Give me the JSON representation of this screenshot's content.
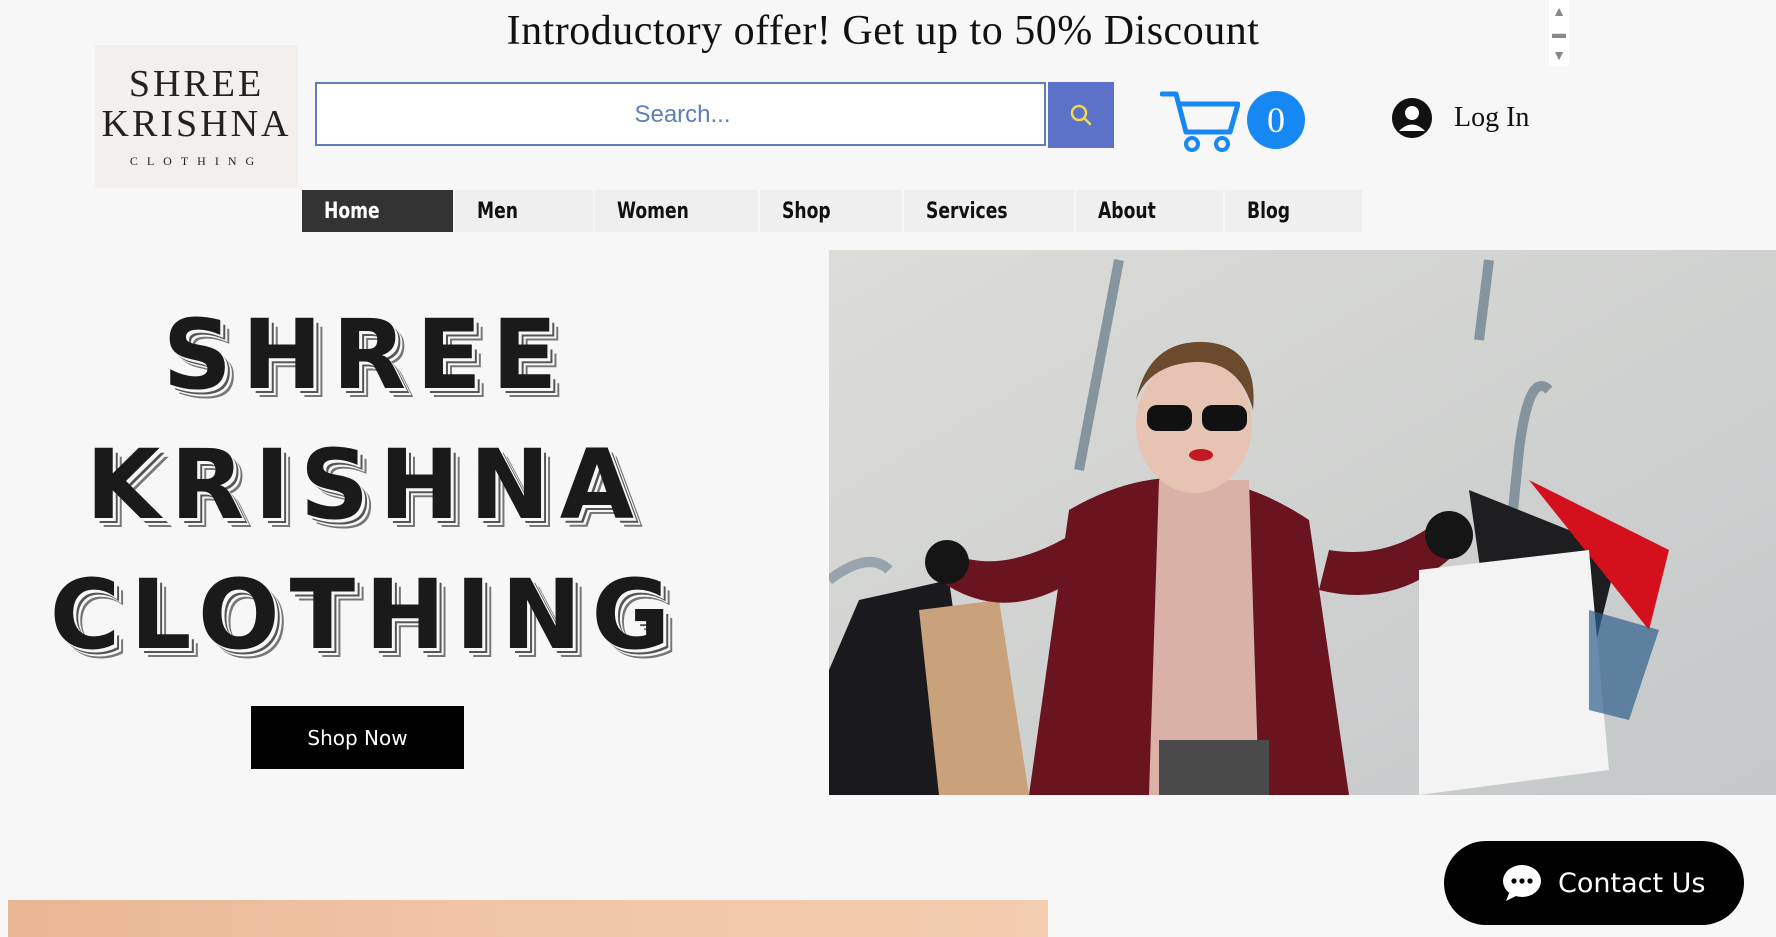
{
  "announcement": {
    "text": "Introductory offer! Get up to 50% Discount"
  },
  "logo": {
    "line1": "SHREE",
    "line2": "KRISHNA",
    "line3": "CLOTHING"
  },
  "search": {
    "placeholder": "Search...",
    "button_icon": "search-icon"
  },
  "cart": {
    "icon": "cart-icon",
    "count": "0",
    "accent": "#1687f3"
  },
  "login": {
    "icon": "user-avatar-icon",
    "label": "Log In"
  },
  "nav": {
    "items": [
      {
        "label": "Home",
        "active": true
      },
      {
        "label": "Men"
      },
      {
        "label": "Women"
      },
      {
        "label": "Shop"
      },
      {
        "label": "Services"
      },
      {
        "label": "About"
      },
      {
        "label": "Blog"
      }
    ]
  },
  "hero": {
    "title_line1": "SHREE",
    "title_line2": "KRISHNA",
    "title_line3": "CLOTHING",
    "cta": "Shop Now"
  },
  "contact": {
    "icon": "chat-bubble-icon",
    "label": "Contact Us"
  },
  "colors": {
    "search_border": "#5e7fb3",
    "search_button": "#5b72c8",
    "nav_active": "#333333",
    "nav_bg": "#efefef"
  }
}
